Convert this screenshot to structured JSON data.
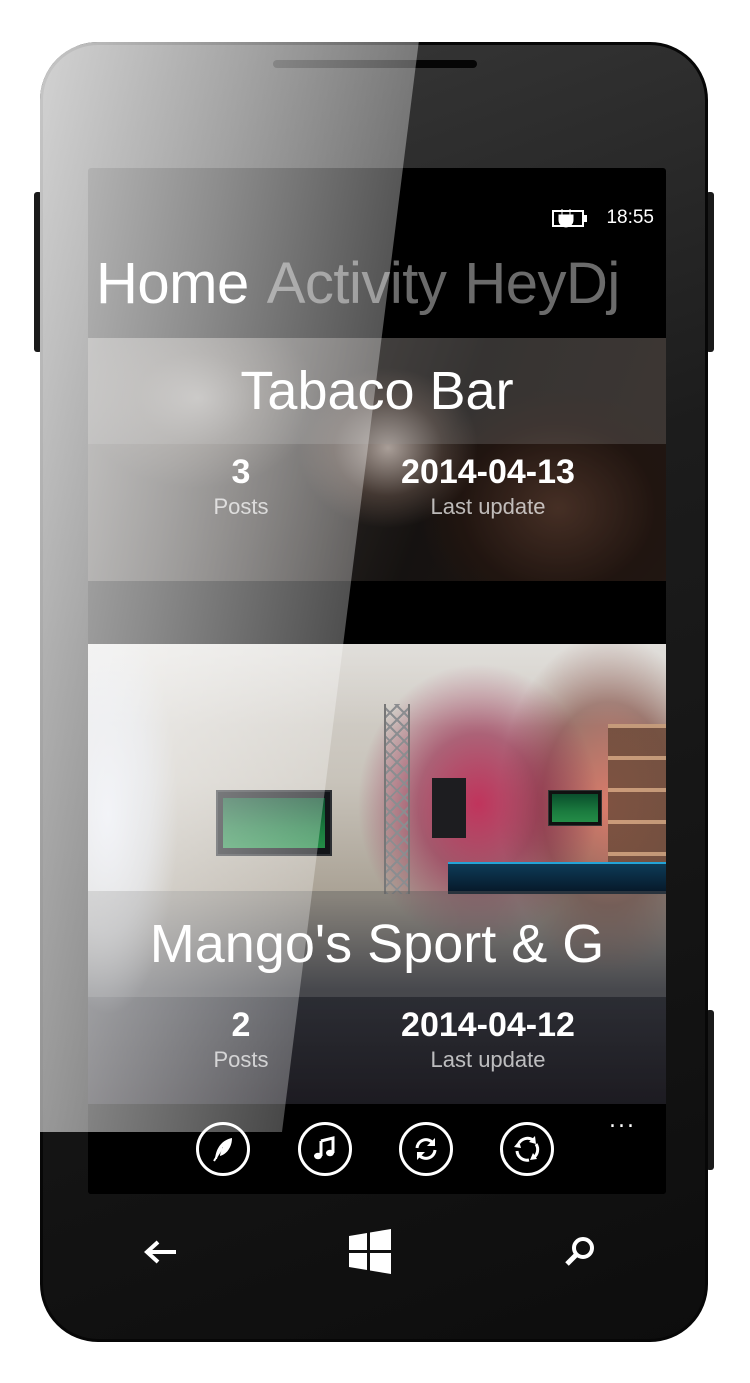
{
  "status_bar": {
    "time": "18:55",
    "battery_icon": "battery-charging-icon"
  },
  "pivot": {
    "items": [
      {
        "label": "Home",
        "active": true
      },
      {
        "label": "Activity",
        "active": false
      },
      {
        "label": "HeyDj",
        "active": false
      }
    ]
  },
  "venues": [
    {
      "title": "Tabaco Bar",
      "posts_value": "3",
      "posts_label": "Posts",
      "update_value": "2014-04-13",
      "update_label": "Last update"
    },
    {
      "title": "Mango's Sport & G",
      "posts_value": "2",
      "posts_label": "Posts",
      "update_value": "2014-04-12",
      "update_label": "Last update"
    }
  ],
  "app_bar": {
    "buttons": [
      "feather-icon",
      "music-note-icon",
      "sync-icon",
      "rotate-icon"
    ],
    "more": "..."
  },
  "hardware_buttons": [
    "back-arrow-icon",
    "windows-start-icon",
    "search-icon"
  ],
  "colors": {
    "screen_bg": "#000000",
    "band_overlay": "#5a5a5a",
    "text": "#ffffff"
  }
}
